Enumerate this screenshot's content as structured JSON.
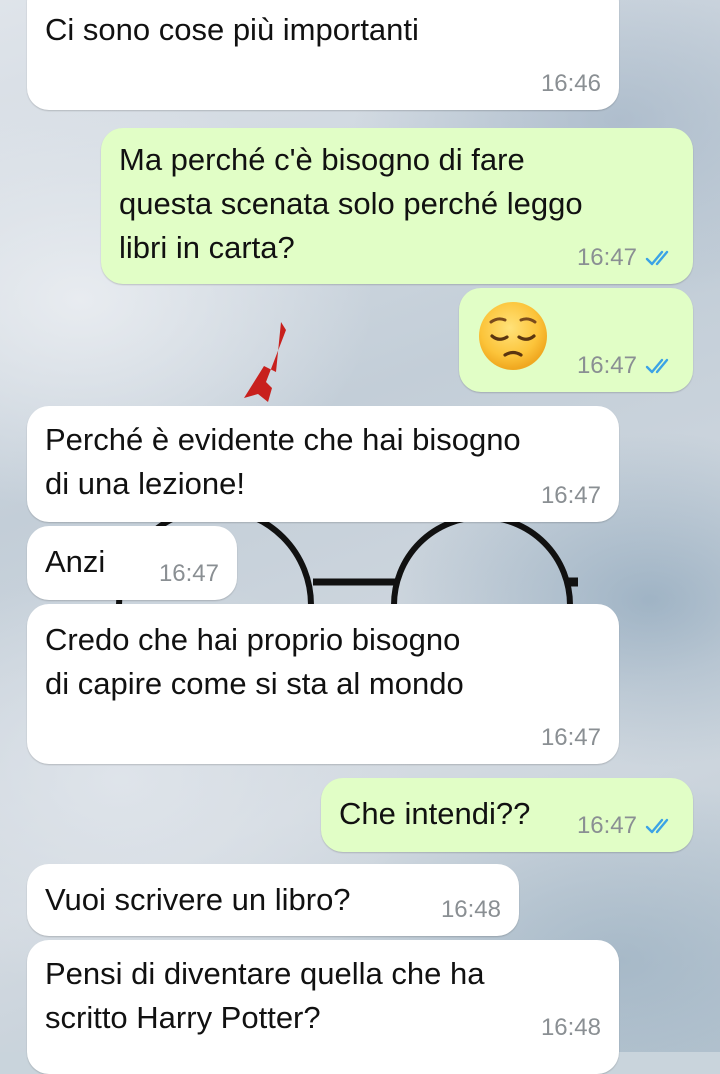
{
  "theme": {
    "incoming_bubble": "#ffffff",
    "outgoing_bubble": "#e1fec6",
    "timestamp_color": "#8a8f93",
    "read_ticks_color": "#3ba3e6"
  },
  "messages": [
    {
      "direction": "in",
      "text": "Ci sono cose più importanti",
      "time": "16:46"
    },
    {
      "direction": "out",
      "text": "Ma perché c'è bisogno di fare\nquesta scenata solo perché leggo\nlibri in carta?",
      "time": "16:47",
      "status": "read-double-check"
    },
    {
      "direction": "out",
      "emoji": "pensive-face-emoji",
      "text": "",
      "time": "16:47",
      "status": "read-double-check"
    },
    {
      "direction": "in",
      "text": "Perché è evidente che hai bisogno\ndi una lezione!",
      "time": "16:47"
    },
    {
      "direction": "in",
      "text": "Anzi",
      "time": "16:47"
    },
    {
      "direction": "in",
      "text": "Credo che hai proprio bisogno\ndi capire come si sta al mondo",
      "time": "16:47"
    },
    {
      "direction": "out",
      "text": "Che intendi??",
      "time": "16:47",
      "status": "read-double-check"
    },
    {
      "direction": "in",
      "text": "Vuoi scrivere un libro?",
      "time": "16:48"
    },
    {
      "direction": "in",
      "text": "Pensi di diventare quella che ha\nscritto Harry Potter?",
      "time": "16:48"
    }
  ]
}
